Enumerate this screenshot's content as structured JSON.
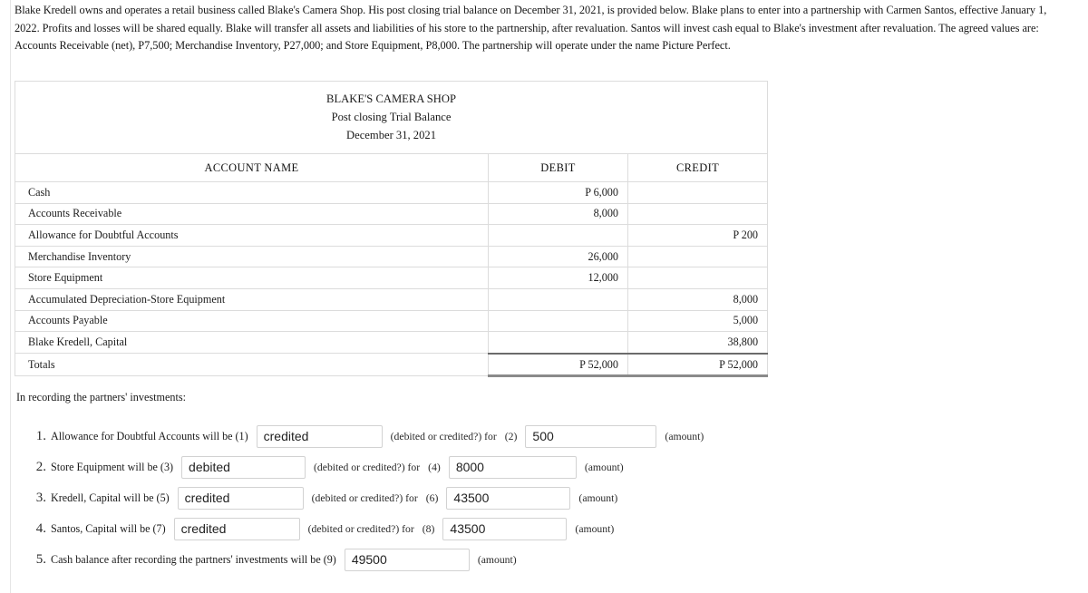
{
  "problem": {
    "paragraph": "Blake Kredell owns and operates a retail business called Blake's Camera Shop. His post closing trial balance on December 31, 2021, is provided below. Blake plans to enter into a partnership with Carmen Santos, effective January 1, 2022. Profits and losses will be shared equally. Blake will transfer all assets and liabilities of his store to the partnership, after revaluation. Santos will invest cash equal to Blake's investment after revaluation. The agreed values are: Accounts Receivable (net), P7,500; Merchandise Inventory, P27,000; and Store Equipment, P8,000.  The partnership will operate under the name Picture Perfect."
  },
  "trial_balance": {
    "title_line_1": "BLAKE'S CAMERA SHOP",
    "title_line_2": "Post closing Trial Balance",
    "title_line_3": "December 31, 2021",
    "headers": {
      "account": "ACCOUNT NAME",
      "debit": "DEBIT",
      "credit": "CREDIT"
    },
    "rows": [
      {
        "account": "Cash",
        "debit": "P 6,000",
        "credit": ""
      },
      {
        "account": "Accounts Receivable",
        "debit": "8,000",
        "credit": ""
      },
      {
        "account": "Allowance for Doubtful Accounts",
        "debit": "",
        "credit": "P 200"
      },
      {
        "account": "Merchandise Inventory",
        "debit": "26,000",
        "credit": ""
      },
      {
        "account": "Store Equipment",
        "debit": "12,000",
        "credit": ""
      },
      {
        "account": "Accumulated Depreciation-Store Equipment",
        "debit": "",
        "credit": "8,000"
      },
      {
        "account": "Accounts Payable",
        "debit": "",
        "credit": "5,000"
      },
      {
        "account": "Blake Kredell, Capital",
        "debit": "",
        "credit": "38,800"
      }
    ],
    "totals": {
      "account": "Totals",
      "debit": "P 52,000",
      "credit": "P 52,000"
    }
  },
  "questions": {
    "heading": "In recording the partners' investments:",
    "debited_or_credited_label": "(debited or credited?) for",
    "amount_label": "(amount)",
    "items": [
      {
        "number": "1.",
        "text": "Allowance for Doubtful Accounts will be (1)",
        "answer_value": "credited",
        "answer_placeholder": "",
        "for_marker": "(2)",
        "amount_value": "500",
        "amount_placeholder": ""
      },
      {
        "number": "2.",
        "text": "Store Equipment will be (3)",
        "answer_value": "debited",
        "answer_placeholder": "",
        "for_marker": "(4)",
        "amount_value": "8000",
        "amount_placeholder": ""
      },
      {
        "number": "3.",
        "text": "Kredell, Capital will be (5)",
        "answer_value": "credited",
        "answer_placeholder": "",
        "for_marker": "(6)",
        "amount_value": "43500",
        "amount_placeholder": ""
      },
      {
        "number": "4.",
        "text": "Santos, Capital will be (7)",
        "answer_value": "credited",
        "answer_placeholder": "",
        "for_marker": "(8)",
        "amount_value": "43500",
        "amount_placeholder": ""
      }
    ],
    "final_item": {
      "number": "5.",
      "text": "Cash balance after recording the partners' investments will be (9)",
      "amount_value": "49500",
      "amount_placeholder": "",
      "amount_label": "(amount)"
    }
  },
  "colors": {
    "text": "#1a1a1a",
    "table_border": "#dcdcdc",
    "rule_dark": "#6b6b6b",
    "input_border": "#d2d2d2"
  }
}
